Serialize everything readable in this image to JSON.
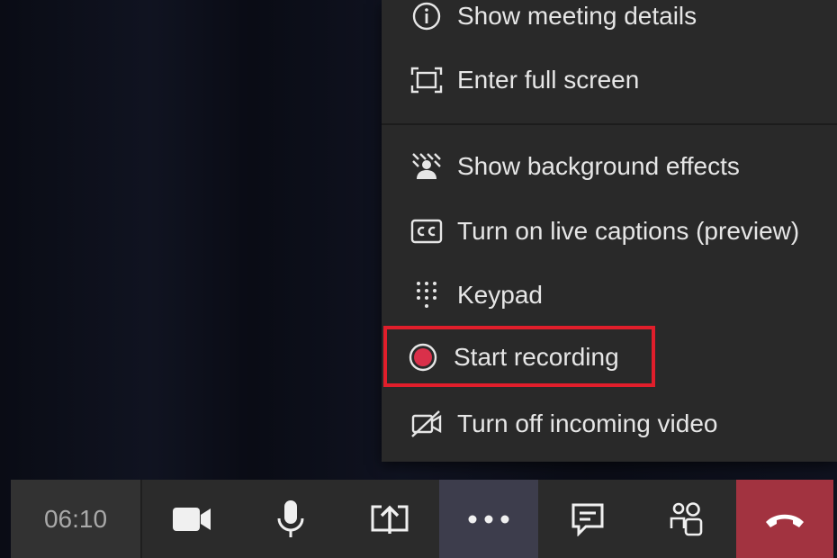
{
  "menu": {
    "items": [
      {
        "label": "Show meeting details",
        "icon": "info-icon"
      },
      {
        "label": "Enter full screen",
        "icon": "full-screen-icon"
      },
      {
        "label": "Show background effects",
        "icon": "background-effects-icon"
      },
      {
        "label": "Turn on live captions (preview)",
        "icon": "captions-icon"
      },
      {
        "label": "Keypad",
        "icon": "keypad-icon"
      },
      {
        "label": "Start recording",
        "icon": "record-icon"
      },
      {
        "label": "Turn off incoming video",
        "icon": "video-off-icon"
      }
    ],
    "highlight_color": "#e01e2b",
    "record_color": "#d9304a"
  },
  "toolbar": {
    "timer": "06:10",
    "buttons": [
      {
        "icon": "camera-icon"
      },
      {
        "icon": "microphone-icon"
      },
      {
        "icon": "share-screen-icon"
      },
      {
        "icon": "more-options-icon"
      },
      {
        "icon": "chat-icon"
      },
      {
        "icon": "participants-icon"
      },
      {
        "icon": "hang-up-icon"
      }
    ],
    "hangup_color": "#a23340"
  }
}
